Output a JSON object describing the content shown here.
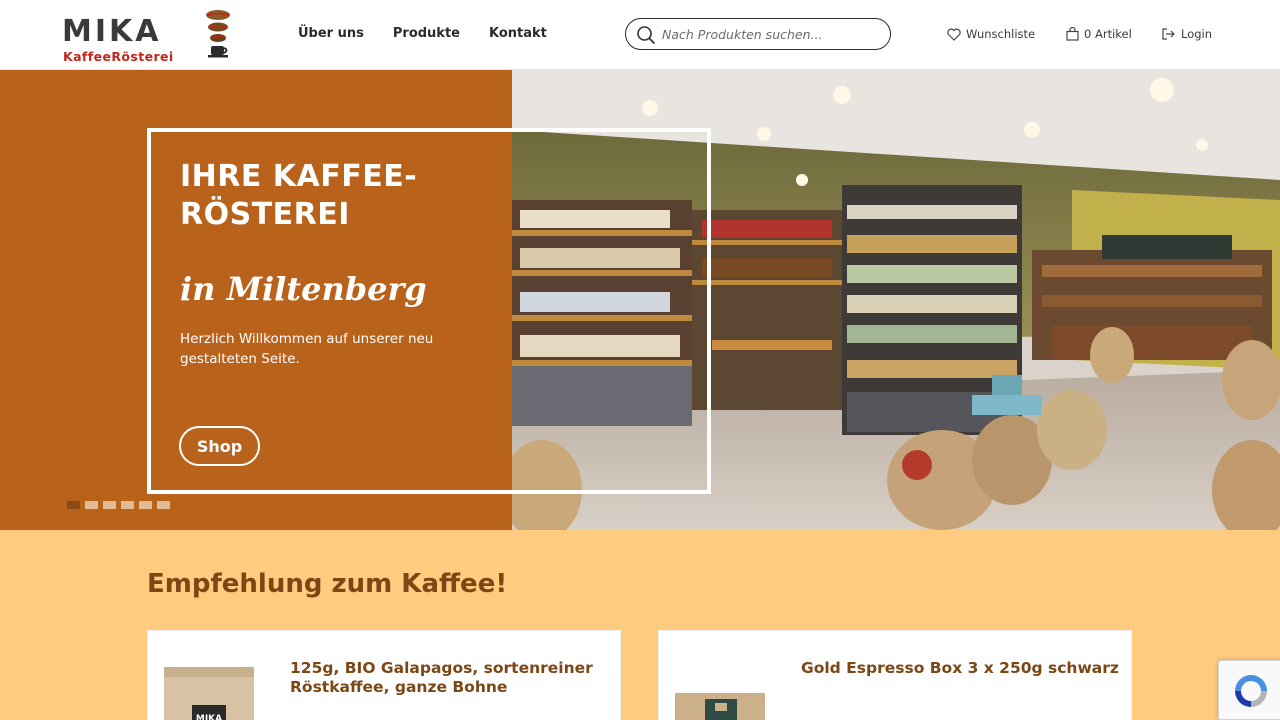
{
  "brand": {
    "name": "MIKA",
    "tagline": "KaffeeRösterei"
  },
  "nav": {
    "items": [
      "Über uns",
      "Produkte",
      "Kontakt"
    ]
  },
  "search": {
    "placeholder": "Nach Produkten suchen..."
  },
  "header_links": {
    "wishlist": "Wunschliste",
    "cart": "0 Artikel",
    "login": "Login"
  },
  "hero": {
    "title": "IHRE KAFFEE-RÖSTEREI",
    "script": "in Miltenberg",
    "text": "Herzlich Willkommen auf unserer neu gestalteten Seite.",
    "button": "Shop",
    "slide_count": 6,
    "active_slide": 1
  },
  "recommendations": {
    "title": "Empfehlung zum Kaffee!",
    "products": [
      {
        "name": "125g, BIO Galapagos, sortenreiner Röstkaffee, ganze Bohne"
      },
      {
        "name": "Gold Espresso Box 3 x 250g schwarz"
      }
    ]
  },
  "colors": {
    "accent_brown": "#b9621b",
    "title_brown": "#7b4715",
    "section_bg": "#ffcb7f",
    "brand_red": "#c0261c"
  },
  "icons": {
    "search": "search-icon",
    "wishlist": "heart-icon",
    "cart": "bag-icon",
    "login": "login-icon"
  }
}
